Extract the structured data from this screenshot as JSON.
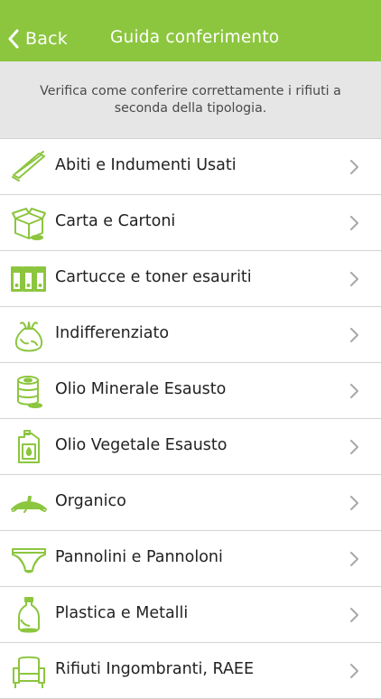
{
  "nav": {
    "back_label": "Back",
    "title": "Guida conferimento",
    "background_color": "#8cc63f"
  },
  "intro": {
    "text": "Verifica come conferire correttamente i rifiuti a seconda della tipologia."
  },
  "accent_color": "#8cc63f",
  "categories": [
    {
      "label": "Abiti e Indumenti Usati",
      "icon": "clothes-hanger-icon"
    },
    {
      "label": "Carta e Cartoni",
      "icon": "cardboard-box-icon"
    },
    {
      "label": "Cartucce e toner esauriti",
      "icon": "toner-cartridges-icon"
    },
    {
      "label": "Indifferenziato",
      "icon": "trash-bag-icon"
    },
    {
      "label": "Olio Minerale Esausto",
      "icon": "oil-barrel-icon"
    },
    {
      "label": "Olio Vegetale Esausto",
      "icon": "oil-jerrycan-icon"
    },
    {
      "label": "Organico",
      "icon": "banana-peel-icon"
    },
    {
      "label": "Pannolini e Pannoloni",
      "icon": "diaper-icon"
    },
    {
      "label": "Plastica e Metalli",
      "icon": "plastic-bottle-icon"
    },
    {
      "label": "Rifiuti Ingombranti, RAEE",
      "icon": "armchair-icon"
    }
  ]
}
